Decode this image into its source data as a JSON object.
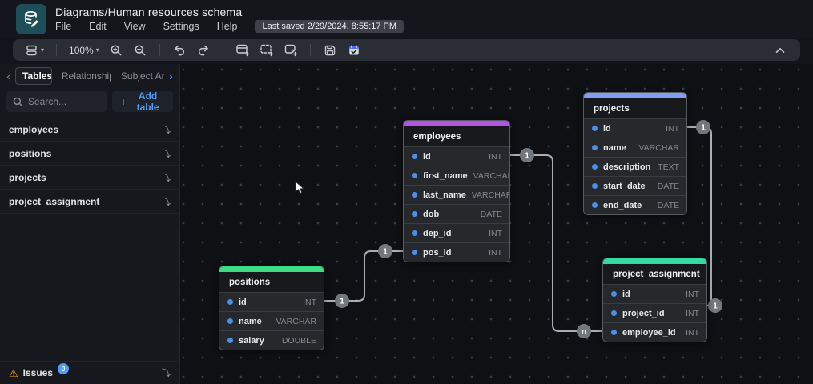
{
  "header": {
    "title": "Diagrams/Human resources schema",
    "menu": [
      "File",
      "Edit",
      "View",
      "Settings",
      "Help"
    ],
    "last_saved": "Last saved 2/29/2024, 8:55:17 PM"
  },
  "toolbar": {
    "zoom_level": "100%",
    "icon_names": [
      "view-mode-icon",
      "zoom-percent-dropdown",
      "zoom-in-icon",
      "zoom-out-icon",
      "undo-icon",
      "redo-icon",
      "add-table-icon",
      "add-area-icon",
      "add-note-icon",
      "save-icon",
      "todo-icon",
      "chevron-up-icon"
    ]
  },
  "sidebar": {
    "tabs": [
      {
        "label": "Tables",
        "active": true
      },
      {
        "label": "Relationships",
        "active": false
      },
      {
        "label": "Subject Are",
        "active": false
      }
    ],
    "search_placeholder": "Search...",
    "add_table_label": "Add table",
    "tables": [
      "employees",
      "positions",
      "projects",
      "project_assignment"
    ],
    "issues": {
      "label": "Issues",
      "count": "0"
    }
  },
  "canvas": {
    "tables": [
      {
        "name": "employees",
        "accent_color": "#b355e3",
        "fields": [
          {
            "name": "id",
            "type": "INT"
          },
          {
            "name": "first_name",
            "type": "VARCHAR"
          },
          {
            "name": "last_name",
            "type": "VARCHAR"
          },
          {
            "name": "dob",
            "type": "DATE"
          },
          {
            "name": "dep_id",
            "type": "INT"
          },
          {
            "name": "pos_id",
            "type": "INT"
          }
        ]
      },
      {
        "name": "projects",
        "accent_color": "#809df2",
        "fields": [
          {
            "name": "id",
            "type": "INT"
          },
          {
            "name": "name",
            "type": "VARCHAR"
          },
          {
            "name": "description",
            "type": "TEXT"
          },
          {
            "name": "start_date",
            "type": "DATE"
          },
          {
            "name": "end_date",
            "type": "DATE"
          }
        ]
      },
      {
        "name": "positions",
        "accent_color": "#3ddc84",
        "fields": [
          {
            "name": "id",
            "type": "INT"
          },
          {
            "name": "name",
            "type": "VARCHAR"
          },
          {
            "name": "salary",
            "type": "DOUBLE"
          }
        ]
      },
      {
        "name": "project_assignment",
        "accent_color": "#35d9a2",
        "fields": [
          {
            "name": "id",
            "type": "INT"
          },
          {
            "name": "project_id",
            "type": "INT"
          },
          {
            "name": "employee_id",
            "type": "INT"
          }
        ]
      }
    ],
    "relationships": [
      {
        "from": "positions.id",
        "to": "employees.pos_id",
        "from_label": "1",
        "to_label": "1"
      },
      {
        "from": "employees.id",
        "to": "project_assignment.employee_id",
        "from_label": "1",
        "to_label": "n"
      },
      {
        "from": "projects.id",
        "to": "project_assignment.project_id",
        "from_label": "1",
        "to_label": "1"
      }
    ]
  }
}
